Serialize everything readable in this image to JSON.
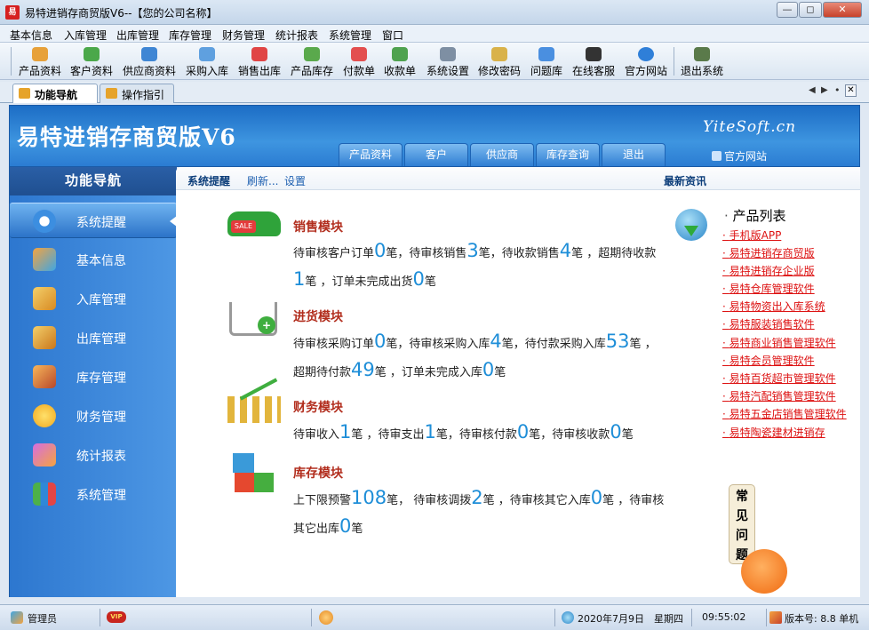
{
  "window": {
    "title": "易特进销存商贸版V6--【您的公司名称】",
    "app_icon": "易"
  },
  "menu": [
    "基本信息",
    "入库管理",
    "出库管理",
    "库存管理",
    "财务管理",
    "统计报表",
    "系统管理",
    "窗口"
  ],
  "toolbar": [
    "产品资料",
    "客户资料",
    "供应商资料",
    "采购入库",
    "销售出库",
    "产品库存",
    "付款单",
    "收款单",
    "系统设置",
    "修改密码",
    "问题库",
    "在线客服",
    "官方网站",
    "退出系统"
  ],
  "tabs": [
    "功能导航",
    "操作指引"
  ],
  "banner": {
    "brand": "易特进销存商贸版V6",
    "nav": [
      "产品资料",
      "客户",
      "供应商",
      "库存查询",
      "退出"
    ],
    "site": "YiteSoft.cn",
    "official": "官方网站"
  },
  "sidebar": {
    "title": "功能导航",
    "items": [
      "系统提醒",
      "基本信息",
      "入库管理",
      "出库管理",
      "库存管理",
      "财务管理",
      "统计报表",
      "系统管理"
    ]
  },
  "header": {
    "reminder": "系统提醒",
    "refresh": "刷新...",
    "settings": "设置",
    "news": "最新资讯"
  },
  "modules": {
    "sales": {
      "title": "销售模块",
      "t1": "待审核客户订单",
      "v1": "0",
      "t2": "笔，待审核销售",
      "v2": "3",
      "t3": "笔，待收款销售",
      "v3": "4",
      "t4": "笔 ，超期待收款",
      "v4": "1",
      "t5": "笔 ，订单未完成出货",
      "v5": "0",
      "t6": "笔"
    },
    "purchase": {
      "title": "进货模块",
      "t1": "待审核采购订单",
      "v1": "0",
      "t2": "笔，待审核采购入库",
      "v2": "4",
      "t3": "笔，待付款采购入库",
      "v3": "53",
      "t4": "笔 ，超期待付款",
      "v4": "49",
      "t5": "笔 ，订单未完成入库",
      "v5": "0",
      "t6": "笔"
    },
    "finance": {
      "title": "财务模块",
      "t1": "待审收入",
      "v1": "1",
      "t2": "笔 ，待审支出",
      "v2": "1",
      "t3": "笔，待审核付款",
      "v3": "0",
      "t4": "笔，待审核收款",
      "v4": "0",
      "t5": "笔"
    },
    "stock": {
      "title": "库存模块",
      "t1": "上下限预警",
      "v1": "108",
      "t2": "笔， 待审核调拨",
      "v2": "2",
      "t3": "笔 ，待审核其它入库",
      "v3": "0",
      "t4": "笔 ，待审核其它出库",
      "v4": "0",
      "t5": "笔"
    }
  },
  "products": {
    "title": "产品列表",
    "items": [
      "手机版APP",
      "易特进销存商贸版",
      "易特进销存企业版",
      "易特仓库管理软件",
      "易特物资出入库系统",
      "易特服装销售软件",
      "易特商业销售管理软件",
      "易特会员管理软件",
      "易特百货超市管理软件",
      "易特汽配销售管理软件",
      "易特五金店销售管理软件",
      "易特陶瓷建材进销存"
    ]
  },
  "faq": [
    "常",
    "见",
    "问",
    "题"
  ],
  "status": {
    "user": "管理员",
    "vip": "VIP",
    "date": "2020年7月9日",
    "weekday": "星期四",
    "time": "09:55:02",
    "version": "版本号: 8.8 单机"
  }
}
